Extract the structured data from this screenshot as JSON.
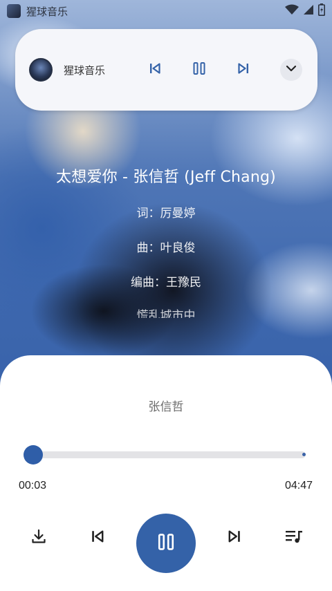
{
  "status_bar": {
    "app_name": "猩球音乐",
    "icons": [
      "wifi-icon",
      "signal-icon",
      "battery-icon"
    ]
  },
  "mini_player": {
    "title": "猩球音乐",
    "icons": [
      "album-art-icon",
      "previous-icon",
      "pause-icon",
      "next-icon",
      "chevron-down-icon"
    ]
  },
  "lyrics": {
    "title": "太想爱你 - 张信哲 (Jeff Chang)",
    "lines": [
      "词：厉曼婷",
      "曲：叶良俊",
      "编曲：王豫民",
      "慌乱城市中"
    ]
  },
  "player": {
    "artist": "张信哲",
    "progress": 0.01,
    "current_time": "00:03",
    "total_time": "04:47",
    "icons": [
      "download-icon",
      "previous-icon",
      "pause-icon",
      "next-icon",
      "playlist-icon"
    ]
  },
  "colors": {
    "accent": "#3462a8",
    "track": "#e3e3e6",
    "card": "#f5f6fa",
    "panel": "#ffffff"
  }
}
